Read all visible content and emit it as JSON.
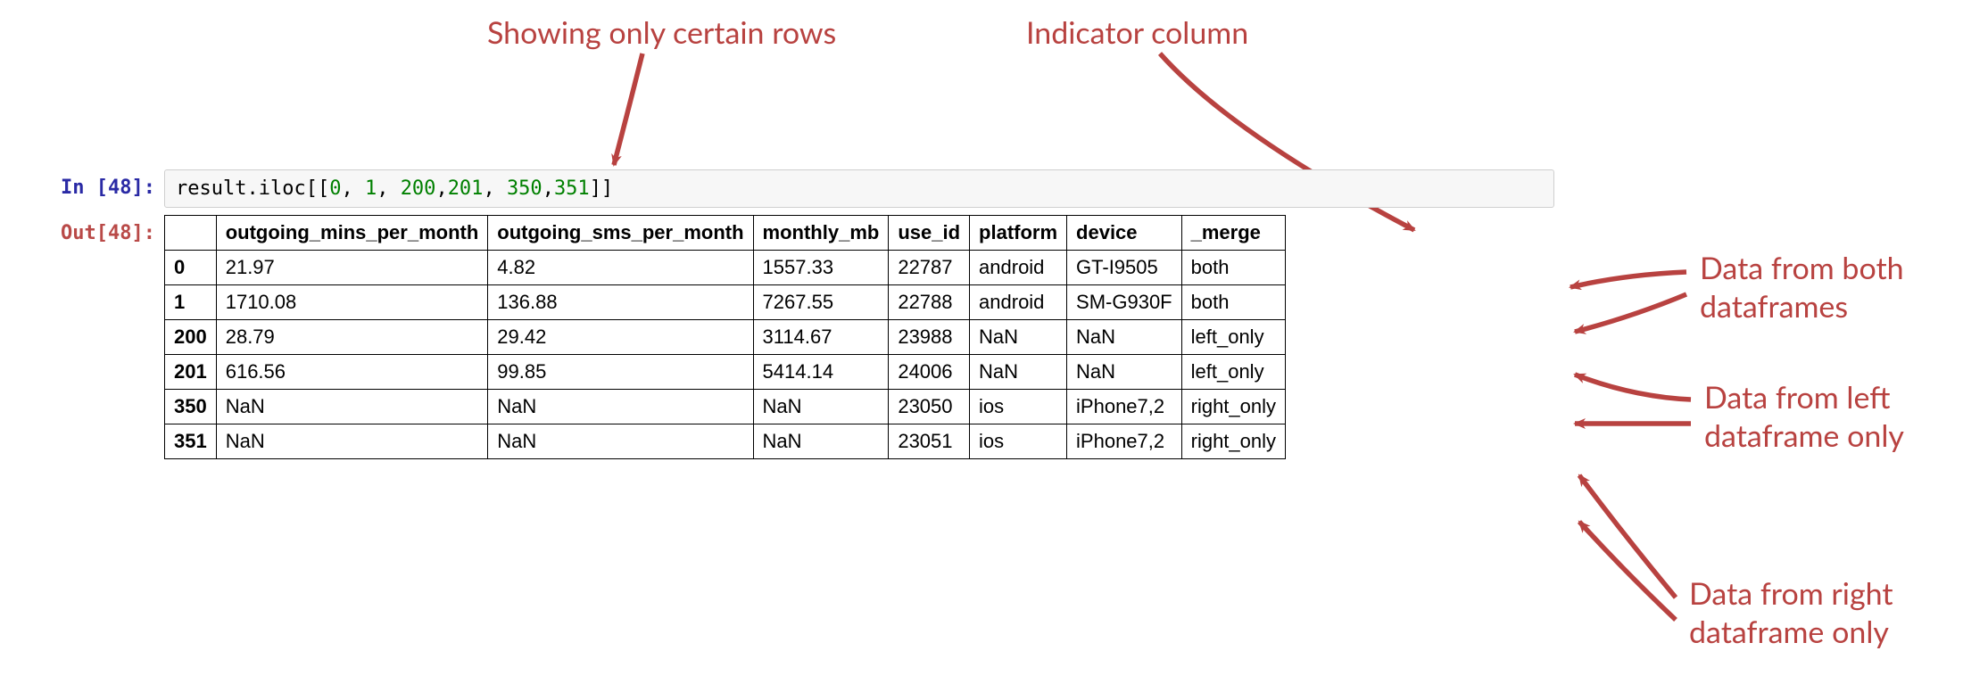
{
  "annotations": {
    "top_left": "Showing only certain rows",
    "top_right": "Indicator column",
    "right_both_l1": "Data from both",
    "right_both_l2": "dataframes",
    "right_left_l1": "Data from left",
    "right_left_l2": "dataframe only",
    "right_right_l1": "Data from right",
    "right_right_l2": "dataframe only"
  },
  "prompts": {
    "in": "In [48]:",
    "out": "Out[48]:"
  },
  "code": {
    "prefix": "result.iloc[[",
    "nums": [
      "0",
      "1",
      "200",
      "201",
      "350",
      "351"
    ],
    "sep": ", ",
    "sep_tight": ",",
    "suffix": "]]"
  },
  "table": {
    "columns": [
      "outgoing_mins_per_month",
      "outgoing_sms_per_month",
      "monthly_mb",
      "use_id",
      "platform",
      "device",
      "_merge"
    ],
    "rows": [
      {
        "idx": "0",
        "cells": [
          "21.97",
          "4.82",
          "1557.33",
          "22787",
          "android",
          "GT-I9505",
          "both"
        ]
      },
      {
        "idx": "1",
        "cells": [
          "1710.08",
          "136.88",
          "7267.55",
          "22788",
          "android",
          "SM-G930F",
          "both"
        ]
      },
      {
        "idx": "200",
        "cells": [
          "28.79",
          "29.42",
          "3114.67",
          "23988",
          "NaN",
          "NaN",
          "left_only"
        ]
      },
      {
        "idx": "201",
        "cells": [
          "616.56",
          "99.85",
          "5414.14",
          "24006",
          "NaN",
          "NaN",
          "left_only"
        ]
      },
      {
        "idx": "350",
        "cells": [
          "NaN",
          "NaN",
          "NaN",
          "23050",
          "ios",
          "iPhone7,2",
          "right_only"
        ]
      },
      {
        "idx": "351",
        "cells": [
          "NaN",
          "NaN",
          "NaN",
          "23051",
          "ios",
          "iPhone7,2",
          "right_only"
        ]
      }
    ]
  }
}
